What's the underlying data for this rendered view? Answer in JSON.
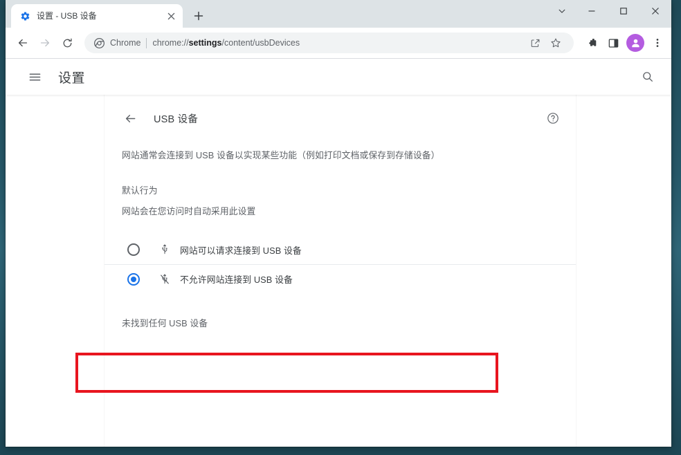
{
  "window": {
    "controls": {
      "tab_search": "tab-search",
      "minimize": "minimize",
      "maximize": "maximize",
      "close": "close"
    }
  },
  "tabstrip": {
    "tabs": [
      {
        "title": "设置 - USB 设备",
        "favicon": "gear-icon",
        "close_label": "关闭"
      }
    ],
    "new_tab_label": "+"
  },
  "toolbar": {
    "back_label": "返回",
    "forward_label": "前进",
    "reload_label": "重新加载",
    "omnibox": {
      "icon": "chrome-logo-icon",
      "scheme_label": "Chrome",
      "url_prefix": "chrome://",
      "url_bold": "settings",
      "url_suffix": "/content/usbDevices",
      "full_url": "chrome://settings/content/usbDevices",
      "share_label": "分享",
      "bookmark_label": "收藏"
    },
    "extensions_label": "扩展程序",
    "side_panel_label": "侧边栏",
    "avatar_label": "个人资料",
    "menu_label": "自定义及控制"
  },
  "settings": {
    "menu_label": "主菜单",
    "title": "设置",
    "search_label": "搜索设置"
  },
  "usb_page": {
    "back_label": "返回",
    "title": "USB 设备",
    "help_label": "帮助",
    "description": "网站通常会连接到 USB 设备以实现某些功能（例如打印文档或保存到存储设备）",
    "default_behavior_label": "默认行为",
    "default_behavior_sub": "网站会在您访问时自动采用此设置",
    "options": [
      {
        "label": "网站可以请求连接到 USB 设备",
        "icon": "usb-icon",
        "selected": false
      },
      {
        "label": "不允许网站连接到 USB 设备",
        "icon": "usb-off-icon",
        "selected": true
      }
    ],
    "empty_state": "未找到任何 USB 设备"
  },
  "annotation": {
    "highlight_color": "#e8151f",
    "target": "不允许网站连接到 USB 设备"
  }
}
